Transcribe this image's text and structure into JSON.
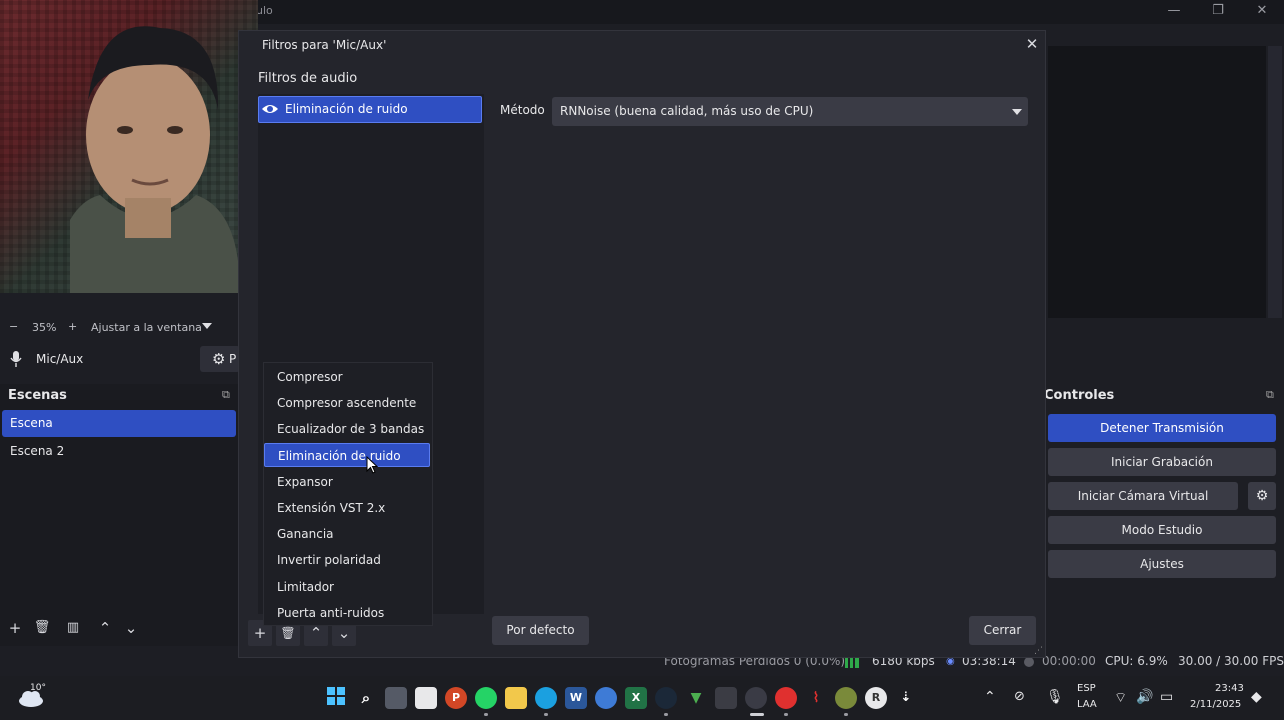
{
  "window": {
    "title": "ulo",
    "minimize_icon": "—",
    "maximize_icon": "❐",
    "close_icon": "✕"
  },
  "preview_bar": {
    "minus": "−",
    "zoom": "35%",
    "plus": "+",
    "fit": "Ajustar a la ventana"
  },
  "audio_source": {
    "name": "Mic/Aux",
    "props_button": "P"
  },
  "scenes": {
    "title": "Escenas",
    "items": [
      "Escena",
      "Escena 2"
    ],
    "toolbar": {
      "add": "+",
      "remove": "🗑",
      "filters": "▥",
      "up": "⌃",
      "down": "⌄"
    }
  },
  "controls": {
    "title": "Controles",
    "buttons": [
      "Detener Transmisión",
      "Iniciar Grabación",
      "Iniciar Cámara Virtual",
      "Modo Estudio",
      "Ajustes"
    ]
  },
  "status": {
    "dropped": "Fotogramas Perdidos 0 (0.0%)",
    "bitrate": "6180 kbps",
    "stream_time": "03:38:14",
    "rec_time": "00:00:00",
    "cpu": "CPU: 6.9%",
    "fps": "30.00 / 30.00 FPS"
  },
  "dialog": {
    "title": "Filtros para 'Mic/Aux'",
    "section_label": "Filtros de audio",
    "filters": [
      "Eliminación de ruido"
    ],
    "method_label": "Método",
    "method_value": "RNNoise (buena calidad, más uso de CPU)",
    "defaults_button": "Por defecto",
    "close_button": "Cerrar",
    "close_icon": "✕"
  },
  "menu": {
    "items": [
      "Compresor",
      "Compresor ascendente",
      "Ecualizador de 3 bandas",
      "Eliminación de ruido",
      "Expansor",
      "Extensión VST 2.x",
      "Ganancia",
      "Invertir polaridad",
      "Limitador",
      "Puerta anti-ruidos"
    ],
    "selected_index": 3
  },
  "taskbar": {
    "weather": "10°",
    "lang_top": "ESP",
    "lang_bottom": "LAA",
    "time": "23:43",
    "date": "2/11/2025"
  },
  "colors": {
    "accent": "#2f4fc2",
    "panel": "#1d1e24",
    "button": "#3a3b45"
  }
}
